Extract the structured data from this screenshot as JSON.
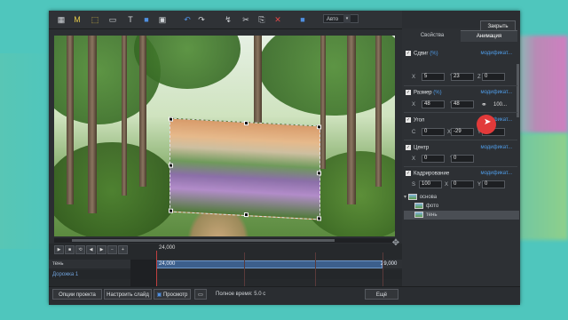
{
  "toolbar": {
    "icons": [
      "film-icon",
      "text-m-icon",
      "crop-frame-icon",
      "video-clip-icon",
      "text-t-icon",
      "rectangle-icon",
      "image-icon",
      "undo-icon",
      "redo-icon",
      "effects-icon",
      "cut-icon",
      "copy-icon",
      "delete-icon",
      "layer-color-icon"
    ],
    "letter_m": "M",
    "letter_t": "T",
    "zoom_value": "Авто",
    "close_label": "Закрыть"
  },
  "panel": {
    "tabs": [
      "Свойства",
      "Анимация"
    ],
    "active_tab": "Анимация",
    "modify_label": "модификат...",
    "shift": {
      "label": "Сдвиг",
      "pct": "(%)",
      "x_label": "X",
      "y_label": "Y",
      "z_label": "Z",
      "x": "5",
      "y": "23",
      "z": "0"
    },
    "size": {
      "label": "Размер",
      "pct": "(%)",
      "x_label": "X",
      "y_label": "Y",
      "x": "48",
      "y": "48",
      "link_value": "100..."
    },
    "angle": {
      "label": "Угол",
      "c_label": "C",
      "x_label": "X",
      "y_label": "Y",
      "c": "0",
      "x": "-29",
      "y": "0"
    },
    "center": {
      "label": "Центр",
      "x_label": "X",
      "y_label": "Y",
      "x": "0",
      "y": "0"
    },
    "crop": {
      "label": "Кадрирование",
      "s_label": "S",
      "x_label": "X",
      "y_label": "Y",
      "s": "100",
      "x": "0",
      "y": "0"
    }
  },
  "tree": {
    "root": "основа",
    "children": [
      "фото",
      "тень"
    ],
    "selected": "тень"
  },
  "timeline": {
    "ruler_value": "24,000",
    "track_main": "тень",
    "track_sub": "Дорожка 1",
    "clip_start": "24,000",
    "clip_end": "29,000"
  },
  "bottom": {
    "project_options": "Опции проекта",
    "slide_settings": "Настроить слайд",
    "preview": "Просмотр",
    "total_time": "Полное время: 5.0 c",
    "more": "Ещё"
  },
  "colors": {
    "accent": "#4f9be6",
    "clip": "#3c5f8c",
    "background": "#4fc6bd"
  }
}
